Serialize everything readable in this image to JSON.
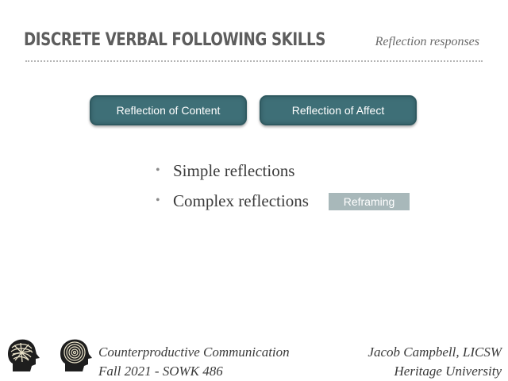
{
  "header": {
    "title": "DISCRETE VERBAL FOLLOWING SKILLS",
    "subtitle": "Reflection responses"
  },
  "buttons": {
    "content_label": "Reflection of Content",
    "affect_label": "Reflection of Affect"
  },
  "bullets": [
    "Simple reflections",
    "Complex reflections"
  ],
  "tag": {
    "label": "Reframing"
  },
  "footer": {
    "left": {
      "line1": "Counterproductive Communication",
      "line2": "Fall 2021 - SOWK 486"
    },
    "right": {
      "line1": "Jacob Campbell, LICSW",
      "line2": "Heritage University"
    },
    "icons": [
      "scribbled-head-icon",
      "spiral-head-icon"
    ]
  },
  "colors": {
    "pill": "#3e6f77",
    "tag": "#a8b8ba",
    "title": "#5d5d5d"
  }
}
